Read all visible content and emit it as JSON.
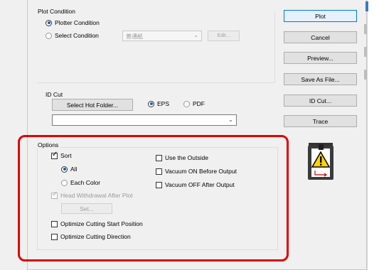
{
  "plot_condition": {
    "legend": "Plot Condition",
    "plotter_condition_label": "Plotter Condition",
    "select_condition_label": "Select Condition",
    "condition_select_value": "普通紙",
    "edit_button": "Edit..."
  },
  "id_cut": {
    "legend": "ID Cut",
    "select_hot_folder_button": "Select Hot Folder...",
    "eps_label": "EPS",
    "pdf_label": "PDF",
    "folder_path_value": ""
  },
  "options": {
    "legend": "Options",
    "sort_label": "Sort",
    "all_label": "All",
    "each_color_label": "Each Color",
    "head_withdrawal_label": "Head Withdrawal After Plot",
    "set_button": "Set...",
    "optimize_start_label": "Optimize Cutting Start Position",
    "optimize_direction_label": "Optimize Cutting Direction",
    "use_outside_label": "Use the Outside",
    "vacuum_on_label": "Vacuum ON Before Output",
    "vacuum_off_label": "Vacuum OFF After Output"
  },
  "buttons": {
    "plot": "Plot",
    "cancel": "Cancel",
    "preview": "Preview...",
    "save_as_file": "Save As File...",
    "id_cut": "ID Cut...",
    "trace": "Trace"
  },
  "state": {
    "plotter_condition_selected": true,
    "eps_selected": true,
    "sort_checked": true,
    "all_selected": true,
    "head_withdrawal_checked": true
  },
  "icons": {
    "warning_machine": "plotter-warning-icon",
    "checkmark": "✓"
  },
  "colors": {
    "highlight_box": "#e00000",
    "primary_button_border": "#0078d7"
  }
}
